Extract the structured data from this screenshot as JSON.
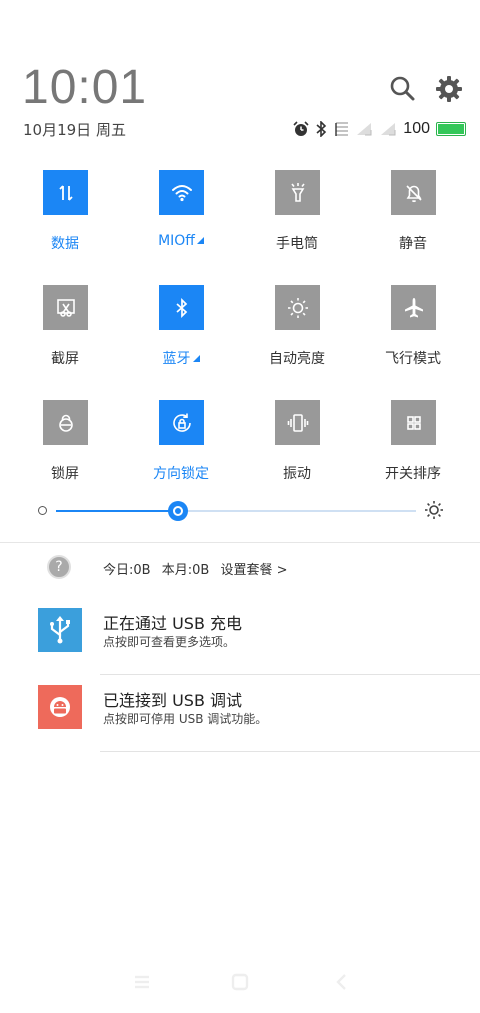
{
  "header": {
    "time": "10:01",
    "date": "10月19日 周五",
    "battery_level": "100",
    "battery_fraction": 1.0,
    "status_icons": [
      "alarm-icon",
      "bluetooth-icon",
      "no-sim-icon",
      "signal-icon",
      "signal-icon"
    ]
  },
  "tiles": [
    {
      "label": "数据",
      "icon": "data-arrows-icon",
      "on": true,
      "triangle": false
    },
    {
      "label": "MIOff",
      "icon": "wifi-icon",
      "on": true,
      "triangle": true
    },
    {
      "label": "手电筒",
      "icon": "flashlight-icon",
      "on": false,
      "triangle": false
    },
    {
      "label": "静音",
      "icon": "mute-bell-icon",
      "on": false,
      "triangle": false
    },
    {
      "label": "截屏",
      "icon": "screenshot-icon",
      "on": false,
      "triangle": false
    },
    {
      "label": "蓝牙",
      "icon": "bluetooth-icon",
      "on": true,
      "triangle": true
    },
    {
      "label": "自动亮度",
      "icon": "auto-brightness-icon",
      "on": false,
      "triangle": false
    },
    {
      "label": "飞行模式",
      "icon": "airplane-icon",
      "on": false,
      "triangle": false
    },
    {
      "label": "锁屏",
      "icon": "lock-icon",
      "on": false,
      "triangle": false
    },
    {
      "label": "方向锁定",
      "icon": "rotation-lock-icon",
      "on": true,
      "triangle": false
    },
    {
      "label": "振动",
      "icon": "vibrate-icon",
      "on": false,
      "triangle": false
    },
    {
      "label": "开关排序",
      "icon": "sort-grid-icon",
      "on": false,
      "triangle": false
    }
  ],
  "brightness": {
    "level": 0.34
  },
  "data_usage": {
    "today": "今日:0B",
    "month": "本月:0B",
    "settings": "设置套餐 >"
  },
  "notifications": [
    {
      "title": "正在通过 USB 充电",
      "subtitle": "点按即可查看更多选项。",
      "icon": "usb-icon",
      "color": "#3b9fdc"
    },
    {
      "title": "已连接到 USB 调试",
      "subtitle": "点按即可停用 USB 调试功能。",
      "icon": "android-debug-icon",
      "color": "#ee6a5b"
    }
  ],
  "colors": {
    "accent": "#1b86f5",
    "tile_off": "#999999"
  }
}
